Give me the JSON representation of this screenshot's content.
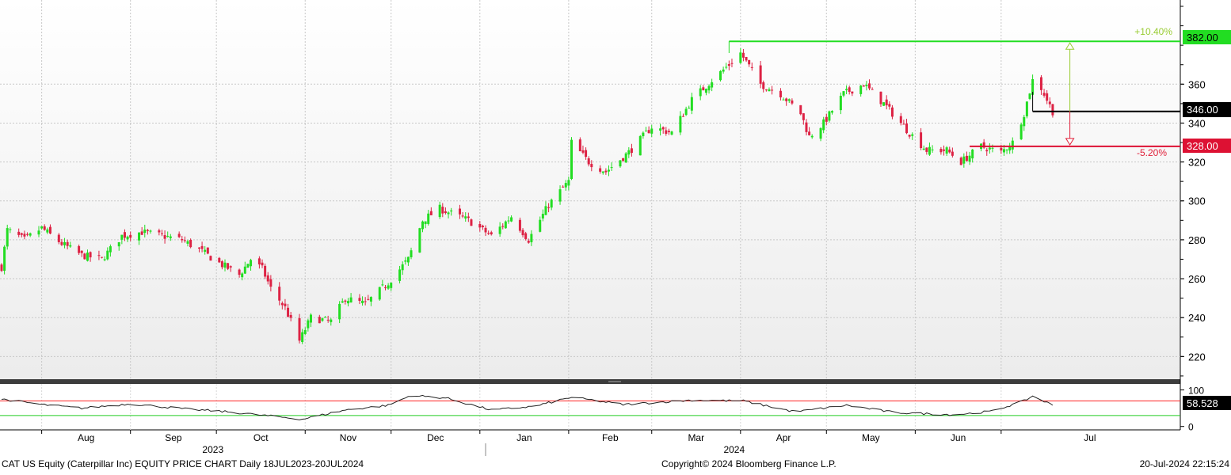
{
  "chart_data": {
    "type": "candlestick",
    "price_axis": {
      "ylim": [
        212,
        400
      ],
      "ticks": [
        "220",
        "240",
        "260",
        "280",
        "300",
        "320",
        "340",
        "360"
      ]
    },
    "months": [
      {
        "label": "Aug",
        "date": "2023-08-01"
      },
      {
        "label": "Sep",
        "date": "2023-09-01"
      },
      {
        "label": "Oct",
        "date": "2023-10-01"
      },
      {
        "label": "Nov",
        "date": "2023-11-01"
      },
      {
        "label": "Dec",
        "date": "2023-12-01"
      },
      {
        "label": "Jan",
        "date": "2024-01-01"
      },
      {
        "label": "Feb",
        "date": "2024-02-01"
      },
      {
        "label": "Mar",
        "date": "2024-03-01"
      },
      {
        "label": "Apr",
        "date": "2024-04-01"
      },
      {
        "label": "May",
        "date": "2024-05-01"
      },
      {
        "label": "Jun",
        "date": "2024-06-01"
      },
      {
        "label": "Jul",
        "date": "2024-07-01"
      }
    ],
    "years": [
      {
        "label": "2023",
        "date": "2023-10-02"
      },
      {
        "label": "2024",
        "date": "2024-04-01"
      }
    ],
    "price_path": [
      [
        "2023-07-18",
        266
      ],
      [
        "2023-07-20",
        285
      ],
      [
        "2023-07-26",
        280
      ],
      [
        "2023-08-01",
        286
      ],
      [
        "2023-08-08",
        278
      ],
      [
        "2023-08-15",
        272
      ],
      [
        "2023-08-22",
        270
      ],
      [
        "2023-08-29",
        282
      ],
      [
        "2023-09-05",
        284
      ],
      [
        "2023-09-12",
        282
      ],
      [
        "2023-09-19",
        280
      ],
      [
        "2023-09-26",
        274
      ],
      [
        "2023-10-02",
        268
      ],
      [
        "2023-10-09",
        262
      ],
      [
        "2023-10-13",
        270
      ],
      [
        "2023-10-17",
        265
      ],
      [
        "2023-10-20",
        255
      ],
      [
        "2023-10-25",
        245
      ],
      [
        "2023-10-30",
        228
      ],
      [
        "2023-11-03",
        240
      ],
      [
        "2023-11-10",
        238
      ],
      [
        "2023-11-15",
        250
      ],
      [
        "2023-11-22",
        247
      ],
      [
        "2023-11-30",
        258
      ],
      [
        "2023-12-07",
        270
      ],
      [
        "2023-12-12",
        290
      ],
      [
        "2023-12-18",
        296
      ],
      [
        "2023-12-28",
        290
      ],
      [
        "2024-01-05",
        282
      ],
      [
        "2024-01-12",
        292
      ],
      [
        "2024-01-18",
        280
      ],
      [
        "2024-01-25",
        298
      ],
      [
        "2024-02-01",
        310
      ],
      [
        "2024-02-02",
        330
      ],
      [
        "2024-02-08",
        320
      ],
      [
        "2024-02-14",
        315
      ],
      [
        "2024-02-22",
        325
      ],
      [
        "2024-03-01",
        338
      ],
      [
        "2024-03-08",
        335
      ],
      [
        "2024-03-15",
        352
      ],
      [
        "2024-03-22",
        362
      ],
      [
        "2024-03-28",
        370
      ],
      [
        "2024-04-01",
        376
      ],
      [
        "2024-04-08",
        360
      ],
      [
        "2024-04-15",
        355
      ],
      [
        "2024-04-22",
        345
      ],
      [
        "2024-04-25",
        333
      ],
      [
        "2024-04-30",
        340
      ],
      [
        "2024-05-07",
        355
      ],
      [
        "2024-05-14",
        360
      ],
      [
        "2024-05-21",
        350
      ],
      [
        "2024-05-30",
        335
      ],
      [
        "2024-06-05",
        326
      ],
      [
        "2024-06-12",
        326
      ],
      [
        "2024-06-17",
        320
      ],
      [
        "2024-06-24",
        328
      ],
      [
        "2024-07-01",
        325
      ],
      [
        "2024-07-05",
        330
      ],
      [
        "2024-07-09",
        345
      ],
      [
        "2024-07-12",
        362
      ],
      [
        "2024-07-15",
        358
      ],
      [
        "2024-07-19",
        346
      ]
    ],
    "rsi_path": [
      [
        "2023-07-18",
        75
      ],
      [
        "2023-08-01",
        60
      ],
      [
        "2023-08-15",
        50
      ],
      [
        "2023-09-01",
        62
      ],
      [
        "2023-09-20",
        48
      ],
      [
        "2023-10-05",
        40
      ],
      [
        "2023-10-31",
        20
      ],
      [
        "2023-11-15",
        45
      ],
      [
        "2023-11-30",
        58
      ],
      [
        "2023-12-08",
        85
      ],
      [
        "2023-12-20",
        78
      ],
      [
        "2024-01-05",
        45
      ],
      [
        "2024-01-20",
        55
      ],
      [
        "2024-02-02",
        80
      ],
      [
        "2024-02-20",
        60
      ],
      [
        "2024-03-15",
        72
      ],
      [
        "2024-04-02",
        70
      ],
      [
        "2024-04-20",
        40
      ],
      [
        "2024-05-08",
        58
      ],
      [
        "2024-05-25",
        38
      ],
      [
        "2024-06-15",
        32
      ],
      [
        "2024-06-28",
        42
      ],
      [
        "2024-07-09",
        70
      ],
      [
        "2024-07-12",
        83
      ],
      [
        "2024-07-19",
        58.5
      ]
    ],
    "rsi_axis": {
      "ylim": [
        -5,
        112
      ],
      "ticks": [
        "100",
        "0"
      ],
      "upper": 70,
      "lower": 30
    },
    "levels": [
      {
        "name": "high",
        "value": 382,
        "label": "382.00",
        "start_date": "2024-03-28",
        "color": "#22dd22"
      },
      {
        "name": "current",
        "value": 346,
        "label": "346.00",
        "start_date": "2024-07-12",
        "color": "#000000"
      },
      {
        "name": "low",
        "value": 328,
        "label": "328.00",
        "start_date": "2024-06-20",
        "color": "#dd1133"
      }
    ],
    "rsi_last": {
      "value": 58.528,
      "label": "58.528"
    },
    "annotations": {
      "up_pct": "+10.40%",
      "down_pct": "-5.20%",
      "arrow_date": "2024-07-25"
    },
    "colors": {
      "up": "#22dd22",
      "down": "#dd2244",
      "green_text": "#99cc33",
      "red_text": "#e0203a"
    }
  },
  "footer": {
    "left": "CAT US Equity (Caterpillar Inc) EQUITY PRICE CHART  Daily 18JUL2023-20JUL2024",
    "center": "Copyright© 2024 Bloomberg Finance L.P.",
    "right": "20-Jul-2024 22:15:24"
  }
}
